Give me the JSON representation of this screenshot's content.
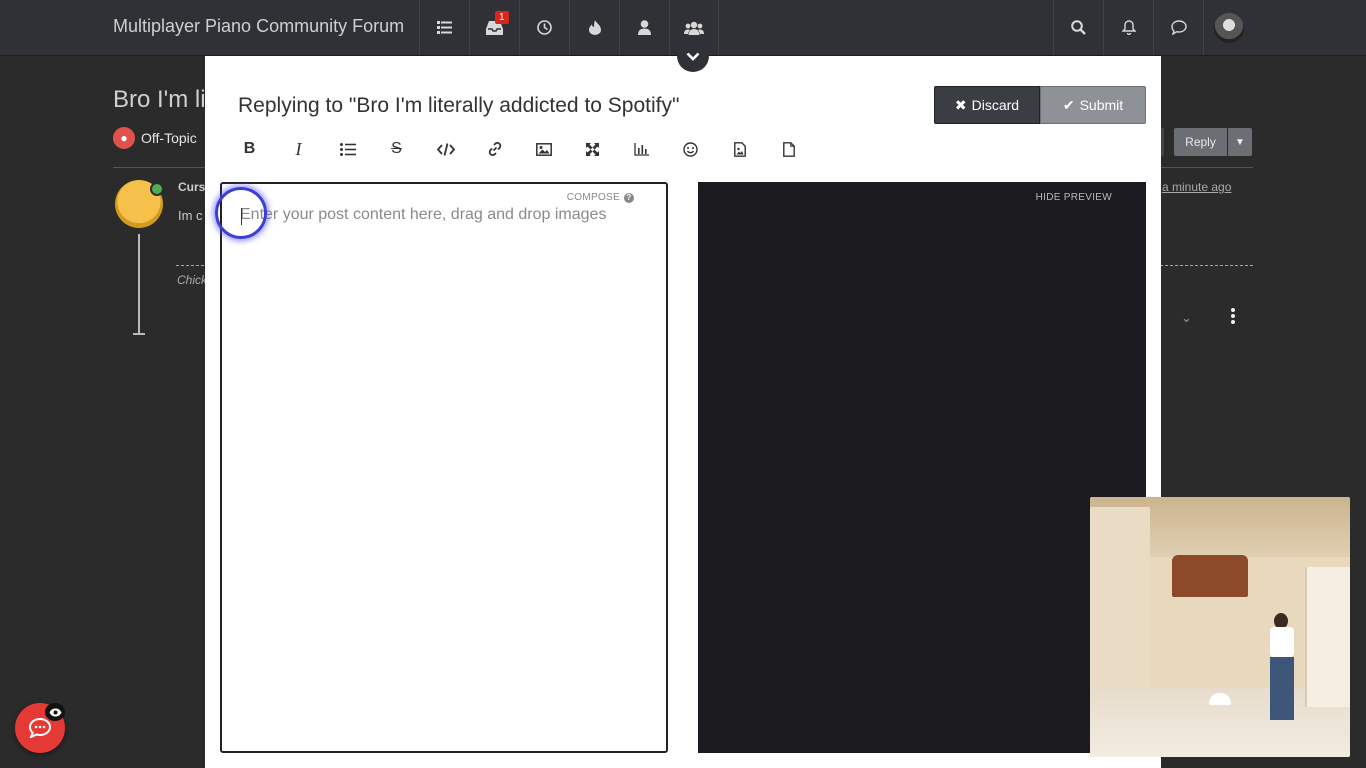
{
  "navbar": {
    "brand": "Multiplayer Piano Community Forum",
    "icons": [
      "list-icon",
      "inbox-icon",
      "clock-icon",
      "fire-icon",
      "user-icon",
      "users-icon"
    ],
    "unread_count": "1",
    "right_icons": [
      "search-icon",
      "bell-icon",
      "chat-icon"
    ]
  },
  "topic": {
    "title_partial": "Bro I'm li",
    "category": "Off-Topic",
    "author_partial": "Curs",
    "post_text_partial": "Im c",
    "signature_partial": "Chick",
    "timestamp": "a minute ago",
    "reply_label": "Reply"
  },
  "composer": {
    "title": "Replying to \"Bro I'm literally addicted to Spotify\"",
    "discard_label": "Discard",
    "submit_label": "Submit",
    "toolbar": [
      "bold-icon",
      "italic-icon",
      "list-icon",
      "strikethrough-icon",
      "code-icon",
      "link-icon",
      "image-icon",
      "fullscreen-icon",
      "chart-icon",
      "emoji-icon",
      "file-image-icon",
      "file-icon"
    ],
    "compose_label": "COMPOSE",
    "placeholder": "Enter your post content here, drag and drop images",
    "hide_preview_label": "HIDE PREVIEW"
  },
  "colors": {
    "accent_red": "#e53935",
    "category_red": "#e0534d",
    "navbar": "#2f3136",
    "discard": "#3a3d42",
    "submit": "#8e9196"
  }
}
